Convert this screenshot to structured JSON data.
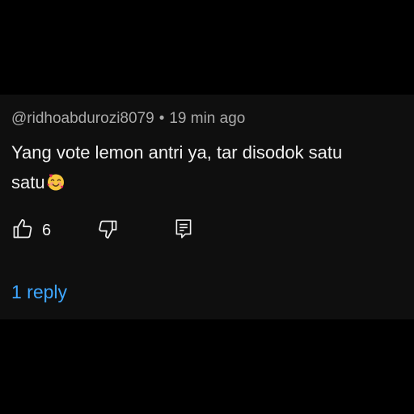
{
  "comment": {
    "author": "@ridhoabdurozi8079",
    "separator": "•",
    "time": "19 min ago",
    "line1": "Yang vote lemon antri ya, tar disodok satu",
    "line2": "satu",
    "emoji": "smiling-face-with-hearts"
  },
  "actions": {
    "like_icon": "thumbs-up-icon",
    "like_count": "6",
    "dislike_icon": "thumbs-down-icon",
    "reply_icon": "reply-comment-icon"
  },
  "replies": {
    "label": "1 reply"
  },
  "colors": {
    "background": "#000000",
    "card": "#0f0f0f",
    "meta_text": "#aaaaaa",
    "body_text": "#f1f1f1",
    "link": "#3ea6ff"
  }
}
